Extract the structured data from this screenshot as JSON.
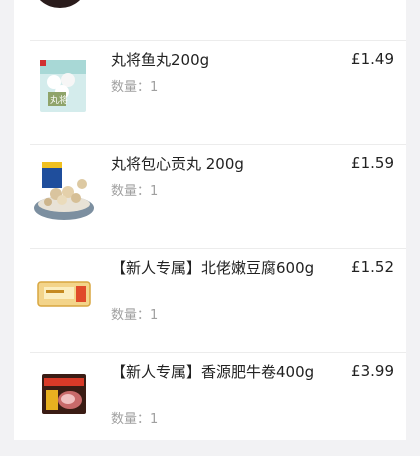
{
  "items": [
    {
      "name": "丸将鱼丸200g",
      "qty_label": "数量：",
      "qty": "1",
      "price": "£1.49"
    },
    {
      "name": "丸将包心贡丸 200g",
      "qty_label": "数量：",
      "qty": "1",
      "price": "£1.59"
    },
    {
      "name": "【新人专属】北佬嫩豆腐600g",
      "qty_label": "数量：",
      "qty": "1",
      "price": "£1.52"
    },
    {
      "name": "【新人专属】香源肥牛卷400g",
      "qty_label": "数量：",
      "qty": "1",
      "price": "£3.99"
    }
  ]
}
